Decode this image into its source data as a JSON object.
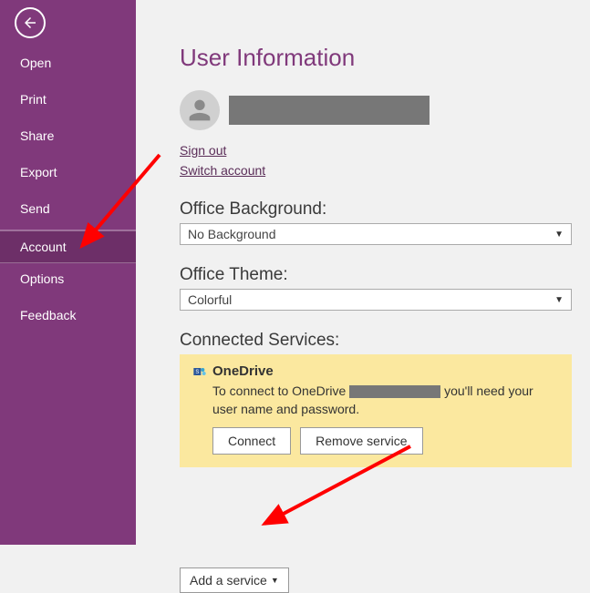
{
  "sidebar": {
    "items": [
      {
        "label": "Open"
      },
      {
        "label": "Print"
      },
      {
        "label": "Share"
      },
      {
        "label": "Export"
      },
      {
        "label": "Send"
      },
      {
        "label": "Account"
      },
      {
        "label": "Options"
      },
      {
        "label": "Feedback"
      }
    ]
  },
  "page": {
    "title": "User Information",
    "sign_out": "Sign out",
    "switch_account": "Switch account",
    "bg_label": "Office Background:",
    "bg_value": "No Background",
    "theme_label": "Office Theme:",
    "theme_value": "Colorful",
    "services_label": "Connected Services:",
    "onedrive": {
      "title": "OneDrive",
      "desc_pre": "To connect to OneDrive",
      "desc_post": "you'll need your user name and password.",
      "connect": "Connect",
      "remove": "Remove service"
    },
    "add_service": "Add a service"
  }
}
